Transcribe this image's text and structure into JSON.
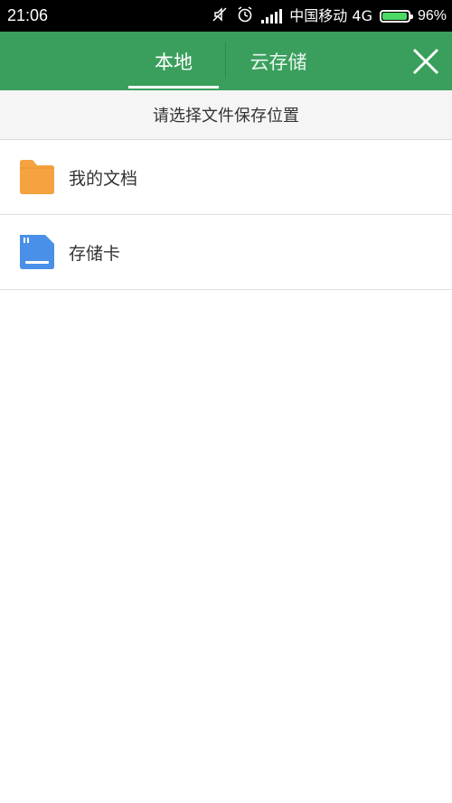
{
  "status_bar": {
    "time": "21:06",
    "carrier": "中国移动 4G",
    "battery_percent": "96%",
    "battery_level": 0.96
  },
  "header": {
    "tabs": [
      {
        "label": "本地",
        "selected": true
      },
      {
        "label": "云存储",
        "selected": false
      }
    ],
    "accent_color": "#3a9f5c"
  },
  "subheader": {
    "text": "请选择文件保存位置"
  },
  "list": {
    "items": [
      {
        "label": "我的文档",
        "icon": "folder-icon",
        "icon_color": "#f4a340"
      },
      {
        "label": "存储卡",
        "icon": "sd-card-icon",
        "icon_color": "#4a90e8"
      }
    ]
  }
}
